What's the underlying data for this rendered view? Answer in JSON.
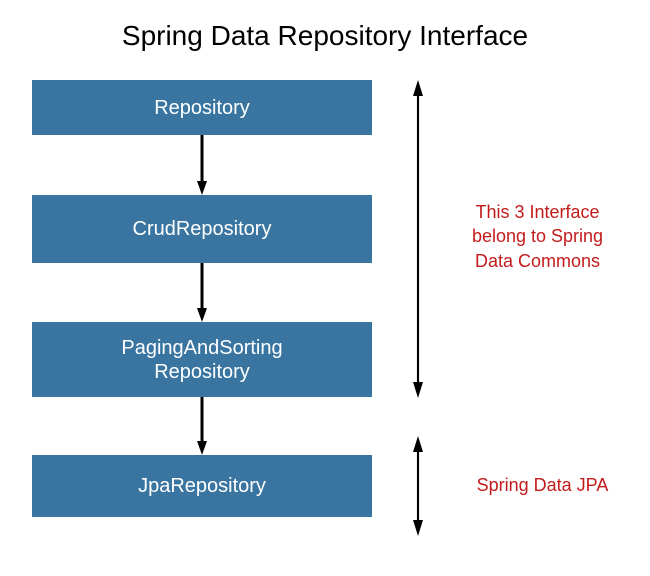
{
  "title": "Spring Data Repository Interface",
  "boxes": {
    "b1": "Repository",
    "b2": "CrudRepository",
    "b3": "PagingAndSorting\nRepository",
    "b4": "JpaRepository"
  },
  "annotations": {
    "a1": "This 3 Interface\nbelong to Spring\nData Commons",
    "a2": "Spring Data JPA"
  },
  "colors": {
    "box_bg": "#3a75a1",
    "box_fg": "#ffffff",
    "annotation": "#c31b1b"
  }
}
